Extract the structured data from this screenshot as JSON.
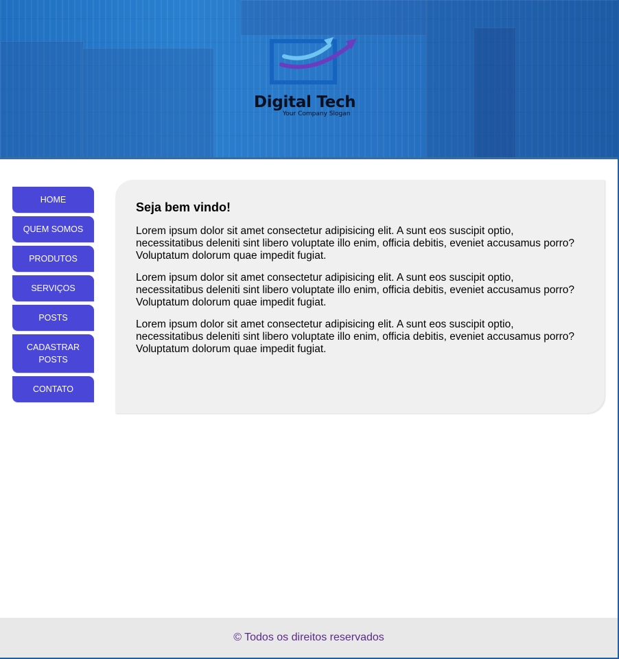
{
  "header": {
    "logo": {
      "name": "Digital Tech",
      "slogan": "Your Company Slogan"
    }
  },
  "nav": {
    "items": [
      {
        "label": "HOME"
      },
      {
        "label": "QUEM SOMOS"
      },
      {
        "label": "PRODUTOS"
      },
      {
        "label": "SERVIÇOS"
      },
      {
        "label": "POSTS"
      },
      {
        "label": "CADASTRAR POSTS"
      },
      {
        "label": "CONTATO"
      }
    ]
  },
  "main": {
    "title": "Seja bem vindo!",
    "paragraphs": [
      "Lorem ipsum dolor sit amet consectetur adipisicing elit. A sunt eos suscipit optio, necessitatibus deleniti sint libero voluptate illo enim, officia debitis, eveniet accusamus porro? Voluptatum dolorum quae impedit fugiat.",
      "Lorem ipsum dolor sit amet consectetur adipisicing elit. A sunt eos suscipit optio, necessitatibus deleniti sint libero voluptate illo enim, officia debitis, eveniet accusamus porro? Voluptatum dolorum quae impedit fugiat.",
      "Lorem ipsum dolor sit amet consectetur adipisicing elit. A sunt eos suscipit optio, necessitatibus deleniti sint libero voluptate illo enim, officia debitis, eveniet accusamus porro? Voluptatum dolorum quae impedit fugiat."
    ]
  },
  "footer": {
    "copyright": "© Todos os direitos reservados"
  },
  "colors": {
    "nav_background": "#4a47d8",
    "header_blue": "#2a80d0",
    "content_background": "#f0f0f0",
    "footer_text": "#5a2a8a"
  }
}
